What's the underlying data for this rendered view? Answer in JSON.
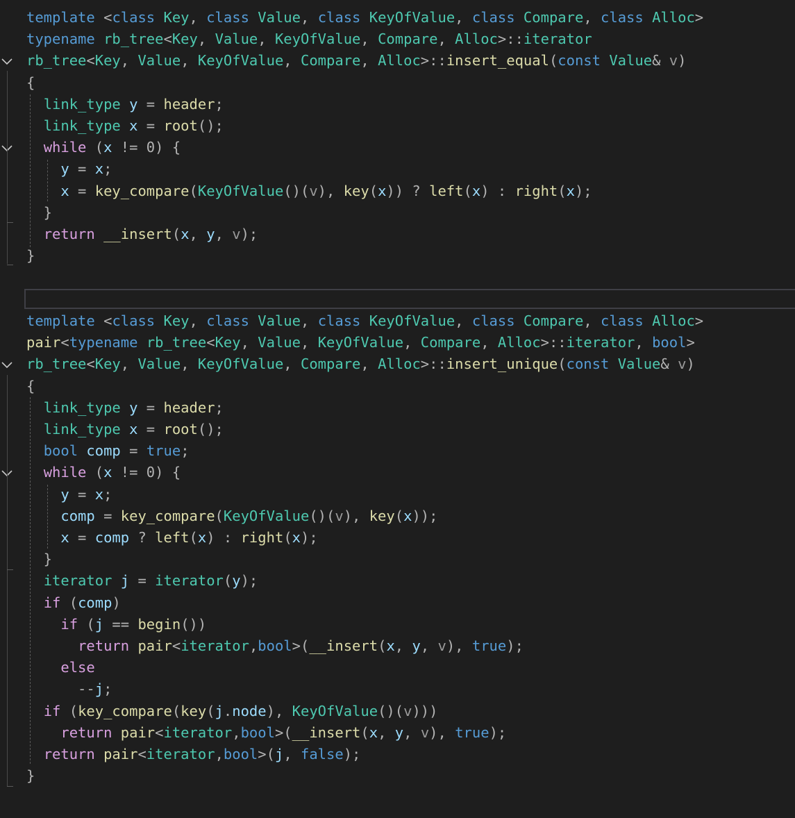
{
  "editor": {
    "theme": "dark",
    "colors": {
      "background": "#1e1e1e",
      "keyword": "#569cd6",
      "type": "#4ec9b0",
      "function": "#dcdcaa",
      "control": "#d8a0df",
      "parameter": "#9a9a9a",
      "variable": "#9cdcfe",
      "plain": "#dcdcdc"
    },
    "block1": {
      "lines": [
        [
          [
            "kw",
            "template "
          ],
          [
            "pu",
            "<"
          ],
          [
            "kw",
            "class "
          ],
          [
            "ty",
            "Key"
          ],
          [
            "pu",
            ", "
          ],
          [
            "kw",
            "class "
          ],
          [
            "ty",
            "Value"
          ],
          [
            "pu",
            ", "
          ],
          [
            "kw",
            "class "
          ],
          [
            "ty",
            "KeyOfValue"
          ],
          [
            "pu",
            ", "
          ],
          [
            "kw",
            "class "
          ],
          [
            "ty",
            "Compare"
          ],
          [
            "pu",
            ", "
          ],
          [
            "kw",
            "class "
          ],
          [
            "ty",
            "Alloc"
          ],
          [
            "pu",
            ">"
          ]
        ],
        [
          [
            "kw",
            "typename "
          ],
          [
            "ty",
            "rb_tree"
          ],
          [
            "pu",
            "<"
          ],
          [
            "ty",
            "Key"
          ],
          [
            "pu",
            ", "
          ],
          [
            "ty",
            "Value"
          ],
          [
            "pu",
            ", "
          ],
          [
            "ty",
            "KeyOfValue"
          ],
          [
            "pu",
            ", "
          ],
          [
            "ty",
            "Compare"
          ],
          [
            "pu",
            ", "
          ],
          [
            "ty",
            "Alloc"
          ],
          [
            "pu",
            ">::"
          ],
          [
            "ty",
            "iterator"
          ]
        ],
        [
          [
            "ty",
            "rb_tree"
          ],
          [
            "pu",
            "<"
          ],
          [
            "ty",
            "Key"
          ],
          [
            "pu",
            ", "
          ],
          [
            "ty",
            "Value"
          ],
          [
            "pu",
            ", "
          ],
          [
            "ty",
            "KeyOfValue"
          ],
          [
            "pu",
            ", "
          ],
          [
            "ty",
            "Compare"
          ],
          [
            "pu",
            ", "
          ],
          [
            "ty",
            "Alloc"
          ],
          [
            "pu",
            ">::"
          ],
          [
            "fn",
            "insert_equal"
          ],
          [
            "pu",
            "("
          ],
          [
            "kw",
            "const "
          ],
          [
            "ty",
            "Value"
          ],
          [
            "pu",
            "& "
          ],
          [
            "pm",
            "v"
          ],
          [
            "pu",
            ")"
          ]
        ],
        [
          [
            "pu",
            "{"
          ]
        ],
        [
          [
            "pu",
            "  "
          ],
          [
            "ty",
            "link_type "
          ],
          [
            "var",
            "y"
          ],
          [
            "pu",
            " = "
          ],
          [
            "fn",
            "header"
          ],
          [
            "pu",
            ";"
          ]
        ],
        [
          [
            "pu",
            "  "
          ],
          [
            "ty",
            "link_type "
          ],
          [
            "var",
            "x"
          ],
          [
            "pu",
            " = "
          ],
          [
            "fn",
            "root"
          ],
          [
            "pu",
            "();"
          ]
        ],
        [
          [
            "pu",
            "  "
          ],
          [
            "ctl",
            "while "
          ],
          [
            "pu",
            "("
          ],
          [
            "var",
            "x"
          ],
          [
            "pu",
            " != 0) {"
          ]
        ],
        [
          [
            "pu",
            "    "
          ],
          [
            "var",
            "y"
          ],
          [
            "pu",
            " = "
          ],
          [
            "var",
            "x"
          ],
          [
            "pu",
            ";"
          ]
        ],
        [
          [
            "pu",
            "    "
          ],
          [
            "var",
            "x"
          ],
          [
            "pu",
            " = "
          ],
          [
            "fn",
            "key_compare"
          ],
          [
            "pu",
            "("
          ],
          [
            "ty",
            "KeyOfValue"
          ],
          [
            "pu",
            "()("
          ],
          [
            "pm",
            "v"
          ],
          [
            "pu",
            "), "
          ],
          [
            "fn",
            "key"
          ],
          [
            "pu",
            "("
          ],
          [
            "var",
            "x"
          ],
          [
            "pu",
            ")) ? "
          ],
          [
            "fn",
            "left"
          ],
          [
            "pu",
            "("
          ],
          [
            "var",
            "x"
          ],
          [
            "pu",
            ") : "
          ],
          [
            "fn",
            "right"
          ],
          [
            "pu",
            "("
          ],
          [
            "var",
            "x"
          ],
          [
            "pu",
            ");"
          ]
        ],
        [
          [
            "pu",
            "  }"
          ]
        ],
        [
          [
            "pu",
            "  "
          ],
          [
            "ctl",
            "return "
          ],
          [
            "fn",
            "__insert"
          ],
          [
            "pu",
            "("
          ],
          [
            "var",
            "x"
          ],
          [
            "pu",
            ", "
          ],
          [
            "var",
            "y"
          ],
          [
            "pu",
            ", "
          ],
          [
            "pm",
            "v"
          ],
          [
            "pu",
            ");"
          ]
        ],
        [
          [
            "pu",
            "}"
          ]
        ]
      ]
    },
    "block2": {
      "lines": [
        [
          [
            "kw",
            "template "
          ],
          [
            "pu",
            "<"
          ],
          [
            "kw",
            "class "
          ],
          [
            "ty",
            "Key"
          ],
          [
            "pu",
            ", "
          ],
          [
            "kw",
            "class "
          ],
          [
            "ty",
            "Value"
          ],
          [
            "pu",
            ", "
          ],
          [
            "kw",
            "class "
          ],
          [
            "ty",
            "KeyOfValue"
          ],
          [
            "pu",
            ", "
          ],
          [
            "kw",
            "class "
          ],
          [
            "ty",
            "Compare"
          ],
          [
            "pu",
            ", "
          ],
          [
            "kw",
            "class "
          ],
          [
            "ty",
            "Alloc"
          ],
          [
            "pu",
            ">"
          ]
        ],
        [
          [
            "fn",
            "pair"
          ],
          [
            "pu",
            "<"
          ],
          [
            "kw",
            "typename "
          ],
          [
            "ty",
            "rb_tree"
          ],
          [
            "pu",
            "<"
          ],
          [
            "ty",
            "Key"
          ],
          [
            "pu",
            ", "
          ],
          [
            "ty",
            "Value"
          ],
          [
            "pu",
            ", "
          ],
          [
            "ty",
            "KeyOfValue"
          ],
          [
            "pu",
            ", "
          ],
          [
            "ty",
            "Compare"
          ],
          [
            "pu",
            ", "
          ],
          [
            "ty",
            "Alloc"
          ],
          [
            "pu",
            ">::"
          ],
          [
            "ty",
            "iterator"
          ],
          [
            "pu",
            ", "
          ],
          [
            "kw",
            "bool"
          ],
          [
            "pu",
            ">"
          ]
        ],
        [
          [
            "ty",
            "rb_tree"
          ],
          [
            "pu",
            "<"
          ],
          [
            "ty",
            "Key"
          ],
          [
            "pu",
            ", "
          ],
          [
            "ty",
            "Value"
          ],
          [
            "pu",
            ", "
          ],
          [
            "ty",
            "KeyOfValue"
          ],
          [
            "pu",
            ", "
          ],
          [
            "ty",
            "Compare"
          ],
          [
            "pu",
            ", "
          ],
          [
            "ty",
            "Alloc"
          ],
          [
            "pu",
            ">::"
          ],
          [
            "fn",
            "insert_unique"
          ],
          [
            "pu",
            "("
          ],
          [
            "kw",
            "const "
          ],
          [
            "ty",
            "Value"
          ],
          [
            "pu",
            "& "
          ],
          [
            "pm",
            "v"
          ],
          [
            "pu",
            ")"
          ]
        ],
        [
          [
            "pu",
            "{"
          ]
        ],
        [
          [
            "pu",
            "  "
          ],
          [
            "ty",
            "link_type "
          ],
          [
            "var",
            "y"
          ],
          [
            "pu",
            " = "
          ],
          [
            "fn",
            "header"
          ],
          [
            "pu",
            ";"
          ]
        ],
        [
          [
            "pu",
            "  "
          ],
          [
            "ty",
            "link_type "
          ],
          [
            "var",
            "x"
          ],
          [
            "pu",
            " = "
          ],
          [
            "fn",
            "root"
          ],
          [
            "pu",
            "();"
          ]
        ],
        [
          [
            "pu",
            "  "
          ],
          [
            "kw",
            "bool "
          ],
          [
            "var",
            "comp"
          ],
          [
            "pu",
            " = "
          ],
          [
            "kw",
            "true"
          ],
          [
            "pu",
            ";"
          ]
        ],
        [
          [
            "pu",
            "  "
          ],
          [
            "ctl",
            "while "
          ],
          [
            "pu",
            "("
          ],
          [
            "var",
            "x"
          ],
          [
            "pu",
            " != 0) {"
          ]
        ],
        [
          [
            "pu",
            "    "
          ],
          [
            "var",
            "y"
          ],
          [
            "pu",
            " = "
          ],
          [
            "var",
            "x"
          ],
          [
            "pu",
            ";"
          ]
        ],
        [
          [
            "pu",
            "    "
          ],
          [
            "var",
            "comp"
          ],
          [
            "pu",
            " = "
          ],
          [
            "fn",
            "key_compare"
          ],
          [
            "pu",
            "("
          ],
          [
            "ty",
            "KeyOfValue"
          ],
          [
            "pu",
            "()("
          ],
          [
            "pm",
            "v"
          ],
          [
            "pu",
            "), "
          ],
          [
            "fn",
            "key"
          ],
          [
            "pu",
            "("
          ],
          [
            "var",
            "x"
          ],
          [
            "pu",
            "));"
          ]
        ],
        [
          [
            "pu",
            "    "
          ],
          [
            "var",
            "x"
          ],
          [
            "pu",
            " = "
          ],
          [
            "var",
            "comp"
          ],
          [
            "pu",
            " ? "
          ],
          [
            "fn",
            "left"
          ],
          [
            "pu",
            "("
          ],
          [
            "var",
            "x"
          ],
          [
            "pu",
            ") : "
          ],
          [
            "fn",
            "right"
          ],
          [
            "pu",
            "("
          ],
          [
            "var",
            "x"
          ],
          [
            "pu",
            ");"
          ]
        ],
        [
          [
            "pu",
            "  }"
          ]
        ],
        [
          [
            "pu",
            "  "
          ],
          [
            "ty",
            "iterator "
          ],
          [
            "var",
            "j"
          ],
          [
            "pu",
            " = "
          ],
          [
            "ty",
            "iterator"
          ],
          [
            "pu",
            "("
          ],
          [
            "var",
            "y"
          ],
          [
            "pu",
            ");"
          ]
        ],
        [
          [
            "pu",
            "  "
          ],
          [
            "ctl",
            "if "
          ],
          [
            "pu",
            "("
          ],
          [
            "var",
            "comp"
          ],
          [
            "pu",
            ")"
          ]
        ],
        [
          [
            "pu",
            "    "
          ],
          [
            "ctl",
            "if "
          ],
          [
            "pu",
            "("
          ],
          [
            "var",
            "j"
          ],
          [
            "pu",
            " == "
          ],
          [
            "fn",
            "begin"
          ],
          [
            "pu",
            "())"
          ]
        ],
        [
          [
            "pu",
            "      "
          ],
          [
            "ctl",
            "return "
          ],
          [
            "fn",
            "pair"
          ],
          [
            "pu",
            "<"
          ],
          [
            "ty",
            "iterator"
          ],
          [
            "pu",
            ","
          ],
          [
            "kw",
            "bool"
          ],
          [
            "pu",
            ">("
          ],
          [
            "fn",
            "__insert"
          ],
          [
            "pu",
            "("
          ],
          [
            "var",
            "x"
          ],
          [
            "pu",
            ", "
          ],
          [
            "var",
            "y"
          ],
          [
            "pu",
            ", "
          ],
          [
            "pm",
            "v"
          ],
          [
            "pu",
            "), "
          ],
          [
            "kw",
            "true"
          ],
          [
            "pu",
            ");"
          ]
        ],
        [
          [
            "pu",
            "    "
          ],
          [
            "ctl",
            "else"
          ]
        ],
        [
          [
            "pu",
            "      --"
          ],
          [
            "var",
            "j"
          ],
          [
            "pu",
            ";"
          ]
        ],
        [
          [
            "pu",
            "  "
          ],
          [
            "ctl",
            "if "
          ],
          [
            "pu",
            "("
          ],
          [
            "fn",
            "key_compare"
          ],
          [
            "pu",
            "("
          ],
          [
            "fn",
            "key"
          ],
          [
            "pu",
            "("
          ],
          [
            "var",
            "j"
          ],
          [
            "pu",
            "."
          ],
          [
            "var",
            "node"
          ],
          [
            "pu",
            "), "
          ],
          [
            "ty",
            "KeyOfValue"
          ],
          [
            "pu",
            "()("
          ],
          [
            "pm",
            "v"
          ],
          [
            "pu",
            ")))"
          ]
        ],
        [
          [
            "pu",
            "    "
          ],
          [
            "ctl",
            "return "
          ],
          [
            "fn",
            "pair"
          ],
          [
            "pu",
            "<"
          ],
          [
            "ty",
            "iterator"
          ],
          [
            "pu",
            ","
          ],
          [
            "kw",
            "bool"
          ],
          [
            "pu",
            ">("
          ],
          [
            "fn",
            "__insert"
          ],
          [
            "pu",
            "("
          ],
          [
            "var",
            "x"
          ],
          [
            "pu",
            ", "
          ],
          [
            "var",
            "y"
          ],
          [
            "pu",
            ", "
          ],
          [
            "pm",
            "v"
          ],
          [
            "pu",
            "), "
          ],
          [
            "kw",
            "true"
          ],
          [
            "pu",
            ");"
          ]
        ],
        [
          [
            "pu",
            "  "
          ],
          [
            "ctl",
            "return "
          ],
          [
            "fn",
            "pair"
          ],
          [
            "pu",
            "<"
          ],
          [
            "ty",
            "iterator"
          ],
          [
            "pu",
            ","
          ],
          [
            "kw",
            "bool"
          ],
          [
            "pu",
            ">("
          ],
          [
            "var",
            "j"
          ],
          [
            "pu",
            ", "
          ],
          [
            "kw",
            "false"
          ],
          [
            "pu",
            ");"
          ]
        ],
        [
          [
            "pu",
            "}"
          ]
        ]
      ]
    }
  }
}
